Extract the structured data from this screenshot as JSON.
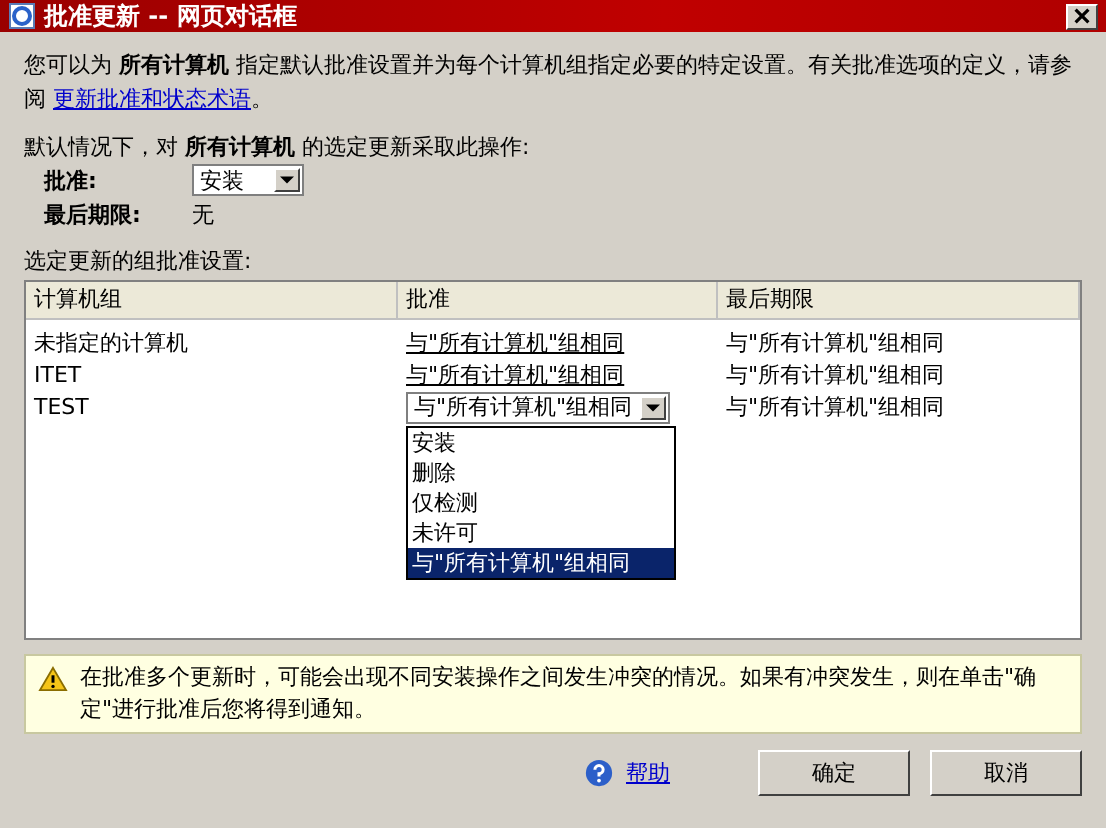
{
  "window": {
    "title": "批准更新 -- 网页对话框"
  },
  "intro": {
    "text": "您可以为 **所有计算机** 指定默认批准设置并为每个计算机组指定必要的特定设置。有关批准选项的定义，请参阅 ",
    "link": "更新批准和状态术语",
    "end": "。"
  },
  "default": {
    "text": "默认情况下，对 **所有计算机** 的选定更新采取此操作:",
    "approval_label": "批准:",
    "approval_value": "安装",
    "deadline_label": "最后期限:",
    "deadline_value": "无"
  },
  "table": {
    "caption": "选定更新的组批准设置:",
    "columns": [
      "计算机组",
      "批准",
      "最后期限"
    ],
    "rows": [
      {
        "group": "未指定的计算机",
        "approval": "与\"所有计算机\"组相同",
        "kind": "link",
        "deadline": "与\"所有计算机\"组相同"
      },
      {
        "group": "ITET",
        "approval": "与\"所有计算机\"组相同",
        "kind": "link",
        "deadline": "与\"所有计算机\"组相同"
      },
      {
        "group": "TEST",
        "approval": "与\"所有计算机\"组相同",
        "kind": "select",
        "deadline": "与\"所有计算机\"组相同"
      }
    ]
  },
  "approval_dropdown": {
    "options": [
      {
        "label": "安装",
        "selected": false
      },
      {
        "label": "删除",
        "selected": false
      },
      {
        "label": "仅检测",
        "selected": false
      },
      {
        "label": "未许可",
        "selected": false
      },
      {
        "label": "与\"所有计算机\"组相同",
        "selected": true
      }
    ]
  },
  "warning": "在批准多个更新时，可能会出现不同安装操作之间发生冲突的情况。如果有冲突发生，则在单击\"确定\"进行批准后您将得到通知。",
  "help": "帮助",
  "buttons": [
    "确定",
    "取消"
  ]
}
